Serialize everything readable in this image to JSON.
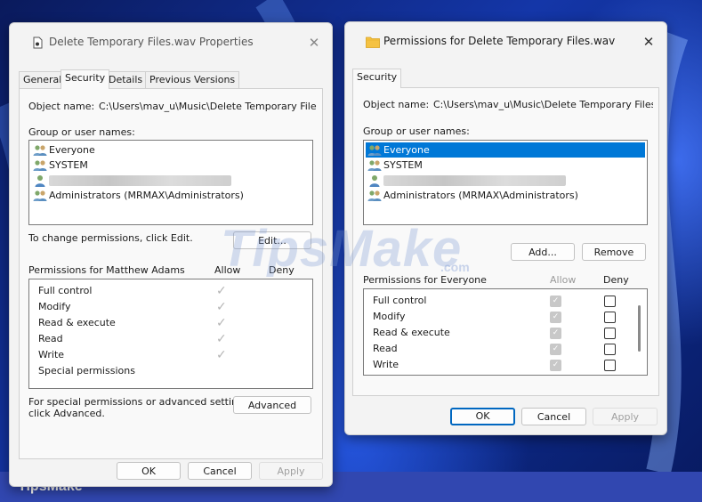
{
  "brand": "TipsMake",
  "watermark": {
    "main": "TipsMake",
    "sub": ".com"
  },
  "props_window": {
    "title": "Delete Temporary Files.wav Properties",
    "tabs": [
      "General",
      "Security",
      "Details",
      "Previous Versions"
    ],
    "active_tab": "Security",
    "object_name_label": "Object name:",
    "object_name_value": "C:\\Users\\mav_u\\Music\\Delete Temporary Files.wa",
    "group_label": "Group or user names:",
    "users": [
      {
        "name": "Everyone",
        "icon": "users-group-icon"
      },
      {
        "name": "SYSTEM",
        "icon": "users-group-icon"
      },
      {
        "name": "",
        "icon": "single-user-icon",
        "redacted": true
      },
      {
        "name": "Administrators (MRMAX\\Administrators)",
        "icon": "users-group-icon"
      }
    ],
    "change_text": "To change permissions, click Edit.",
    "edit_label": "Edit...",
    "perm_for_label": "Permissions for Matthew Adams",
    "allow_label": "Allow",
    "deny_label": "Deny",
    "permissions": [
      {
        "name": "Full control",
        "allow": true
      },
      {
        "name": "Modify",
        "allow": true
      },
      {
        "name": "Read & execute",
        "allow": true
      },
      {
        "name": "Read",
        "allow": true
      },
      {
        "name": "Write",
        "allow": true
      },
      {
        "name": "Special permissions",
        "allow": false
      }
    ],
    "special_text_1": "For special permissions or advanced settings,",
    "special_text_2": "click Advanced.",
    "advanced_label": "Advanced",
    "ok_label": "OK",
    "cancel_label": "Cancel",
    "apply_label": "Apply"
  },
  "perm_window": {
    "title": "Permissions for Delete Temporary Files.wav",
    "tab": "Security",
    "object_name_label": "Object name:",
    "object_name_value": "C:\\Users\\mav_u\\Music\\Delete Temporary Files.wa",
    "group_label": "Group or user names:",
    "users": [
      {
        "name": "Everyone",
        "icon": "users-group-icon",
        "selected": true
      },
      {
        "name": "SYSTEM",
        "icon": "users-group-icon"
      },
      {
        "name": "",
        "icon": "single-user-icon",
        "redacted": true
      },
      {
        "name": "Administrators (MRMAX\\Administrators)",
        "icon": "users-group-icon"
      }
    ],
    "add_label": "Add...",
    "remove_label": "Remove",
    "perm_for_label": "Permissions for Everyone",
    "allow_label": "Allow",
    "deny_label": "Deny",
    "permissions": [
      {
        "name": "Full control",
        "allow": true,
        "deny": false
      },
      {
        "name": "Modify",
        "allow": true,
        "deny": false
      },
      {
        "name": "Read & execute",
        "allow": true,
        "deny": false
      },
      {
        "name": "Read",
        "allow": true,
        "deny": false
      },
      {
        "name": "Write",
        "allow": true,
        "deny": false
      }
    ],
    "ok_label": "OK",
    "cancel_label": "Cancel",
    "apply_label": "Apply"
  },
  "colors": {
    "selection": "#0078d7",
    "accent_border": "#0067c0",
    "brand_bar": "#3147b0"
  }
}
